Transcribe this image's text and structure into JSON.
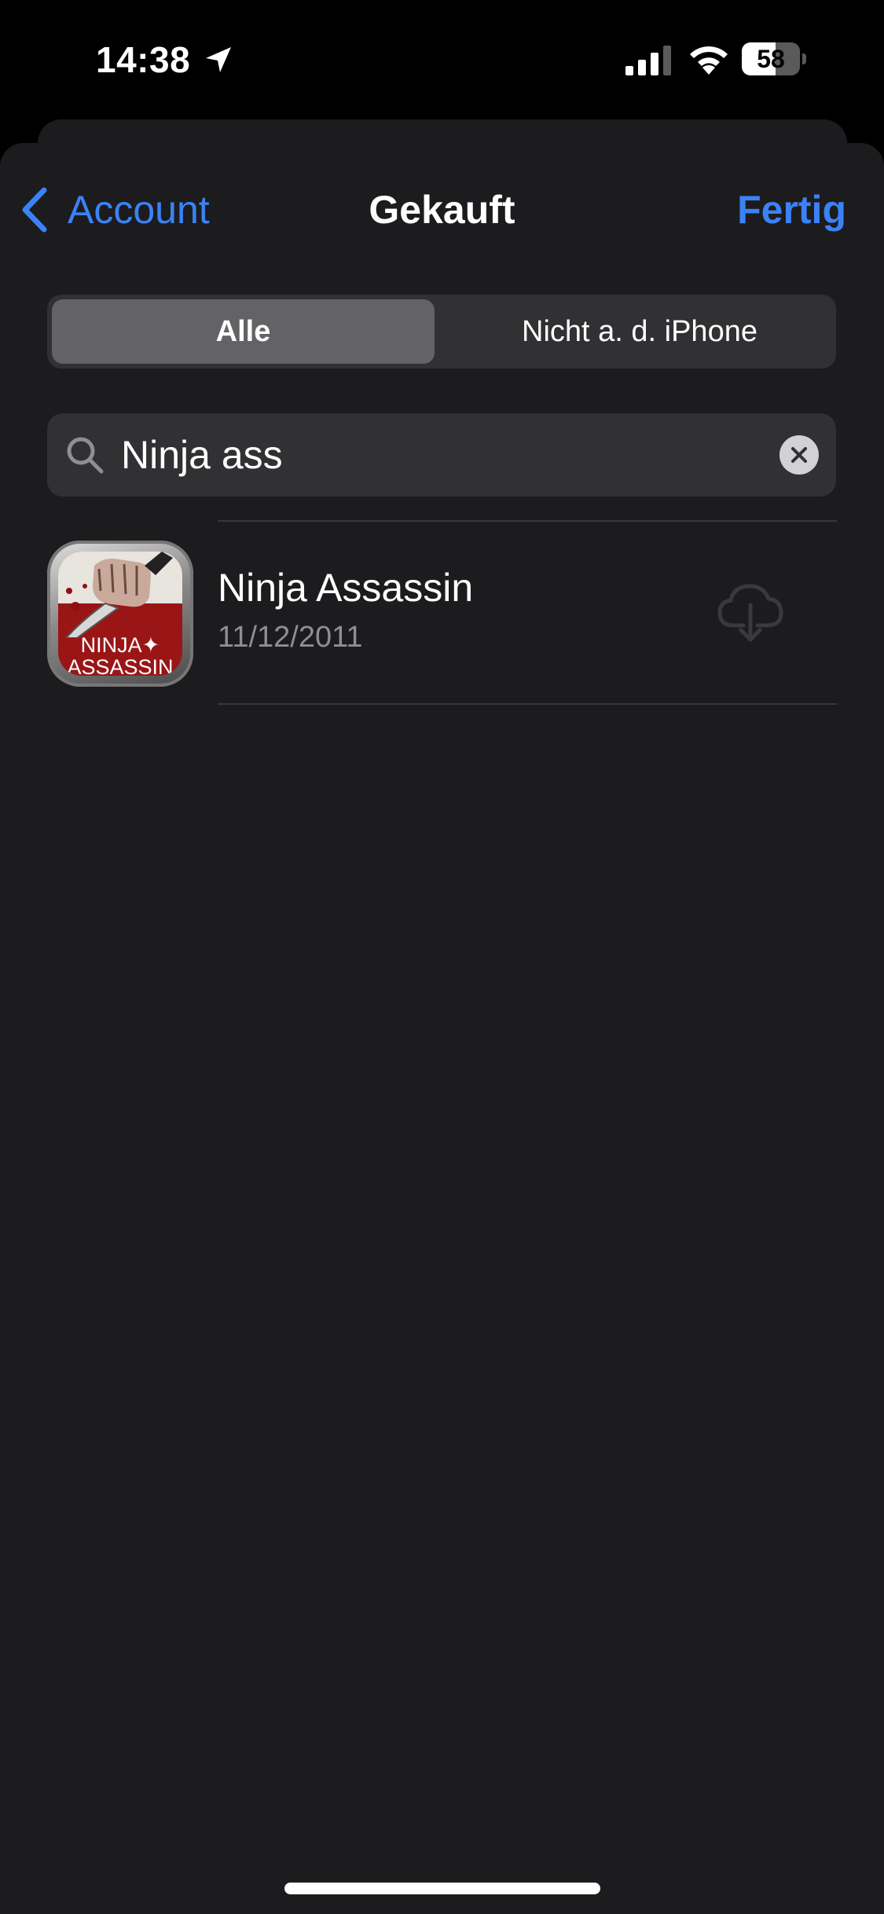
{
  "status_bar": {
    "time": "14:38",
    "battery_percent": "58",
    "battery_level": 0.58
  },
  "nav": {
    "back_label": "Account",
    "title": "Gekauft",
    "done_label": "Fertig"
  },
  "segments": [
    {
      "label": "Alle",
      "selected": true
    },
    {
      "label": "Nicht a. d. iPhone",
      "selected": false
    }
  ],
  "search": {
    "value": "Ninja ass"
  },
  "results": [
    {
      "title": "Ninja Assassin",
      "date": "11/12/2011",
      "icon_text_line1": "NINJA✦",
      "icon_text_line2": "ASSASSIN"
    }
  ],
  "colors": {
    "accent": "#3b82f6",
    "background": "#1c1c1e",
    "secondary_text": "#8e8e93",
    "field_background": "#313134"
  },
  "icons": {
    "location": "location-arrow-icon",
    "signal": "cellular-signal-icon",
    "wifi": "wifi-icon",
    "back": "chevron-left-icon",
    "search": "magnifying-glass-icon",
    "clear": "xmark-circle-icon",
    "download": "icloud-download-icon"
  }
}
